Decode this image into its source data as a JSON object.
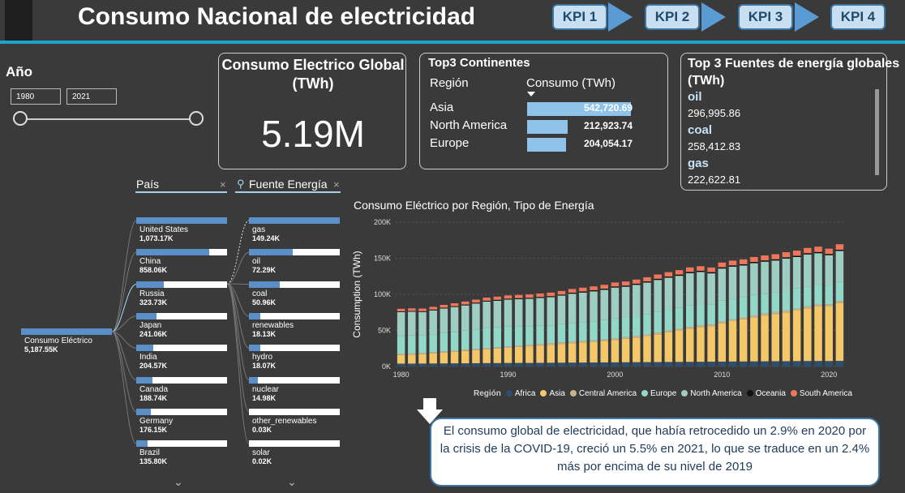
{
  "header": {
    "title": "Consumo Nacional de electricidad",
    "kpi_tabs": [
      "KPI 1",
      "KPI 2",
      "KPI 3",
      "KPI 4"
    ]
  },
  "year_filter": {
    "label": "Año",
    "start": "1980",
    "end": "2021"
  },
  "kpi_card": {
    "title": "Consumo Electrico Global (TWh)",
    "value": "5.19M"
  },
  "top_continents": {
    "title": "Top3 Continentes",
    "col_region": "Región",
    "col_consumo": "Consumo (TWh)",
    "rows": [
      {
        "region": "Asia",
        "value": "542,720.69",
        "amount": 542720.69
      },
      {
        "region": "North America",
        "value": "212,923.74",
        "amount": 212923.74
      },
      {
        "region": "Europe",
        "value": "204,054.17",
        "amount": 204054.17
      }
    ]
  },
  "top_sources": {
    "title": "Top 3 Fuentes de energía globales (TWh)",
    "items": [
      {
        "name": "oil",
        "value": "296,995.86"
      },
      {
        "name": "coal",
        "value": "258,412.83"
      },
      {
        "name": "gas",
        "value": "222,622.81"
      }
    ]
  },
  "decomposition_tree": {
    "root": {
      "label": "Consumo Eléctrico",
      "value": "5,187.55K"
    },
    "country_header": "País",
    "source_header": "Fuente Energía",
    "countries": [
      {
        "label": "United States",
        "value": "1,073.17K",
        "share": 1.0
      },
      {
        "label": "China",
        "value": "858.06K",
        "share": 0.8
      },
      {
        "label": "Russia",
        "value": "323.73K",
        "share": 0.3
      },
      {
        "label": "Japan",
        "value": "241.06K",
        "share": 0.225
      },
      {
        "label": "India",
        "value": "204.57K",
        "share": 0.19
      },
      {
        "label": "Canada",
        "value": "188.74K",
        "share": 0.176
      },
      {
        "label": "Germany",
        "value": "176.15K",
        "share": 0.164
      },
      {
        "label": "Brazil",
        "value": "135.80K",
        "share": 0.127
      }
    ],
    "sources": [
      {
        "label": "gas",
        "value": "149.24K",
        "share": 1.0
      },
      {
        "label": "oil",
        "value": "72.29K",
        "share": 0.484
      },
      {
        "label": "coal",
        "value": "50.96K",
        "share": 0.341
      },
      {
        "label": "renewables",
        "value": "18.13K",
        "share": 0.121
      },
      {
        "label": "hydro",
        "value": "18.07K",
        "share": 0.121
      },
      {
        "label": "nuclear",
        "value": "14.98K",
        "share": 0.1
      },
      {
        "label": "other_renewables",
        "value": "0.03K",
        "share": 0.0
      },
      {
        "label": "solar",
        "value": "0.02K",
        "share": 0.0
      }
    ]
  },
  "chart_data": {
    "type": "bar",
    "stacked": true,
    "title": "Consumo Eléctrico por Región, Tipo de Energía",
    "ylabel": "Consumption (TWh)",
    "xlabel": "",
    "ylim": [
      0,
      200000
    ],
    "yticks": [
      "0K",
      "50K",
      "100K",
      "150K",
      "200K"
    ],
    "xticks": [
      "1980",
      "1990",
      "2000",
      "2010",
      "2020"
    ],
    "legend_title": "Región",
    "categories": [
      1980,
      1981,
      1982,
      1983,
      1984,
      1985,
      1986,
      1987,
      1988,
      1989,
      1990,
      1991,
      1992,
      1993,
      1994,
      1995,
      1996,
      1997,
      1998,
      1999,
      2000,
      2001,
      2002,
      2003,
      2004,
      2005,
      2006,
      2007,
      2008,
      2009,
      2010,
      2011,
      2012,
      2013,
      2014,
      2015,
      2016,
      2017,
      2018,
      2019,
      2020,
      2021
    ],
    "series": [
      {
        "name": "Africa",
        "color": "#2e4e6e",
        "values": [
          4000,
          4000,
          4100,
          4200,
          4300,
          4400,
          4500,
          4600,
          4700,
          4800,
          4900,
          5000,
          5000,
          5100,
          5200,
          5300,
          5400,
          5500,
          5600,
          5700,
          5800,
          5900,
          6000,
          6100,
          6200,
          6300,
          6400,
          6500,
          6600,
          6700,
          6800,
          6900,
          7000,
          7100,
          7200,
          7300,
          7400,
          7500,
          7600,
          7700,
          7600,
          7800
        ]
      },
      {
        "name": "Asia",
        "color": "#f5c76b",
        "values": [
          12000,
          12500,
          13000,
          14000,
          15000,
          16000,
          17000,
          18000,
          19000,
          20000,
          21000,
          22000,
          23000,
          24000,
          25000,
          26000,
          27000,
          28000,
          28500,
          29500,
          31000,
          32500,
          34000,
          36000,
          38500,
          41000,
          43500,
          46000,
          48000,
          49000,
          53000,
          56000,
          58500,
          61000,
          63500,
          65500,
          67500,
          70000,
          73000,
          75500,
          76000,
          80000
        ]
      },
      {
        "name": "Central America",
        "color": "#c8b28a",
        "values": [
          1500,
          1500,
          1500,
          1600,
          1600,
          1600,
          1700,
          1700,
          1700,
          1800,
          1800,
          1800,
          1900,
          1900,
          1900,
          2000,
          2000,
          2000,
          2100,
          2100,
          2100,
          2200,
          2200,
          2200,
          2300,
          2300,
          2300,
          2400,
          2400,
          2400,
          2500,
          2500,
          2500,
          2600,
          2600,
          2600,
          2700,
          2700,
          2700,
          2800,
          2700,
          2800
        ]
      },
      {
        "name": "Europe",
        "color": "#93d7c9",
        "values": [
          25000,
          25000,
          24500,
          25000,
          25500,
          26000,
          26500,
          27000,
          27500,
          27500,
          27500,
          27000,
          26000,
          25500,
          25000,
          25500,
          26000,
          26000,
          26500,
          27000,
          27500,
          28000,
          28000,
          28500,
          29000,
          29000,
          29500,
          29500,
          29500,
          28000,
          29000,
          28500,
          28500,
          28500,
          27500,
          27500,
          28000,
          28000,
          27500,
          27000,
          26000,
          26500
        ]
      },
      {
        "name": "North America",
        "color": "#9ecec2",
        "values": [
          33000,
          33000,
          32500,
          33000,
          34000,
          34500,
          35000,
          36000,
          37000,
          37000,
          37500,
          37500,
          38000,
          38500,
          39000,
          39500,
          40500,
          41000,
          41500,
          42000,
          43000,
          42000,
          43000,
          43500,
          44000,
          44500,
          44000,
          45000,
          44500,
          43000,
          44500,
          44500,
          43500,
          44000,
          44500,
          44000,
          44000,
          43500,
          44500,
          44000,
          42000,
          43000
        ]
      },
      {
        "name": "Oceania",
        "color": "#111111",
        "values": [
          1000,
          1000,
          1000,
          1100,
          1100,
          1100,
          1200,
          1200,
          1200,
          1300,
          1300,
          1300,
          1300,
          1400,
          1400,
          1400,
          1400,
          1500,
          1500,
          1500,
          1500,
          1600,
          1600,
          1600,
          1600,
          1600,
          1700,
          1700,
          1700,
          1700,
          1700,
          1700,
          1700,
          1700,
          1700,
          1700,
          1700,
          1700,
          1700,
          1700,
          1700,
          1700
        ]
      },
      {
        "name": "South America",
        "color": "#f0765b",
        "values": [
          3500,
          3600,
          3700,
          3800,
          3900,
          4000,
          4100,
          4200,
          4300,
          4400,
          4500,
          4600,
          4700,
          4800,
          4900,
          5000,
          5100,
          5200,
          5300,
          5400,
          5500,
          5600,
          5700,
          5800,
          5900,
          6000,
          6100,
          6200,
          6300,
          6400,
          6500,
          6600,
          6700,
          6800,
          6900,
          7000,
          7100,
          7200,
          7300,
          7400,
          7300,
          7600
        ]
      }
    ]
  },
  "note": {
    "text": "El consumo global de electricidad, que había retrocedido un 2.9% en 2020 por la crisis de la COVID-19, creció un 5.5% en 2021, lo que se traduce en un 2.4% más por encima de su nivel de 2019"
  }
}
